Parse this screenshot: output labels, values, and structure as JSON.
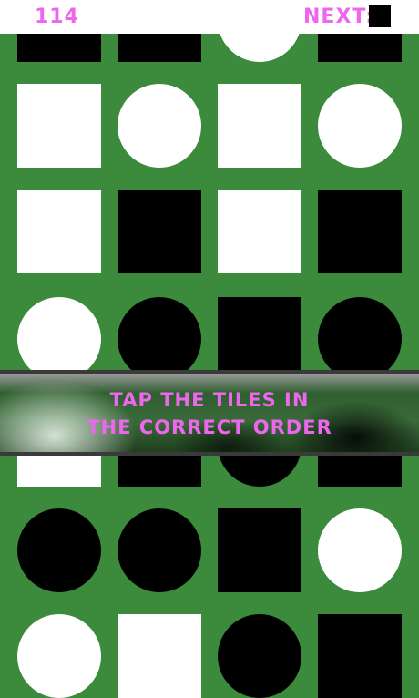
{
  "hud": {
    "score": "114",
    "next_label": "NEXT:",
    "next_tile": "black-square"
  },
  "banner": {
    "line1": "TAP THE TILES IN",
    "line2": "THE CORRECT ORDER"
  },
  "board": {
    "background_color": "#3c8a3c",
    "columns": 4,
    "rows": [
      [
        "black-square",
        "black-square",
        "white-circle",
        "black-square"
      ],
      [
        "white-square",
        "white-circle",
        "white-square",
        "white-circle"
      ],
      [
        "white-square",
        "black-square",
        "white-square",
        "black-square"
      ],
      [
        "white-circle",
        "black-circle",
        "black-square",
        "black-circle"
      ],
      [
        "white-square",
        "black-square",
        "black-circle",
        "black-square"
      ],
      [
        "black-circle",
        "black-circle",
        "black-square",
        "white-circle"
      ],
      [
        "white-circle",
        "white-square",
        "black-circle",
        "black-square"
      ]
    ]
  },
  "colors": {
    "accent_text": "#ee66ee",
    "tile_dark": "#000000",
    "tile_light": "#ffffff"
  }
}
